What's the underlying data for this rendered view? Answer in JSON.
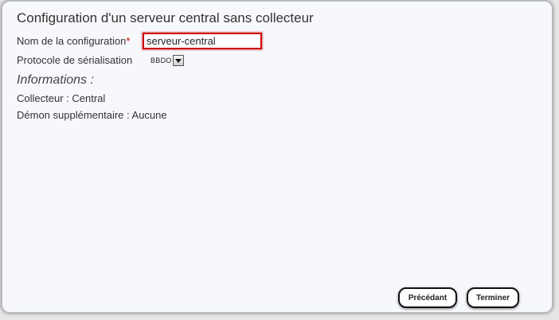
{
  "dialog": {
    "title": "Configuration d'un serveur central sans collecteur"
  },
  "form": {
    "name_label": "Nom de la configuration",
    "required_marker": "*",
    "name_value": "serveur-central",
    "protocol_label": "Protocole de sérialisation",
    "protocol_value": "BBDO"
  },
  "info": {
    "heading": "Informations :",
    "collector_line": "Collecteur : Central",
    "daemon_line": "Démon supplémentaire : Aucune"
  },
  "buttons": {
    "previous": "Précédant",
    "finish": "Terminer"
  },
  "colors": {
    "required": "#cc0000",
    "dialog_background": "#f6f8fc",
    "input_border_error": "#cc0000"
  },
  "icons": {
    "select_arrow": "chevron-down-icon"
  }
}
